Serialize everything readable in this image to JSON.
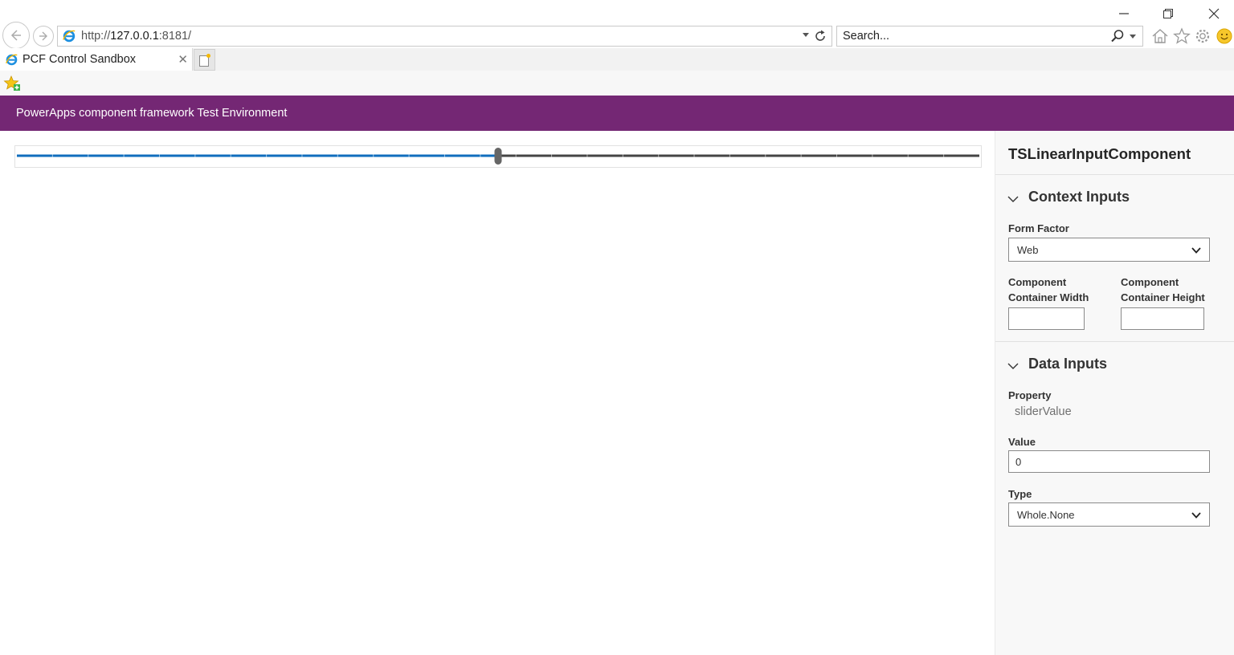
{
  "browser": {
    "address_host": "127.0.0.1",
    "address_prefix": "http://",
    "address_suffix": ":8181/",
    "search_placeholder": "Search...",
    "tab_title": "PCF Control Sandbox"
  },
  "app": {
    "header_title": "PowerApps component framework Test Environment",
    "accent_color": "#742774"
  },
  "slider": {
    "value_fraction": 0.5,
    "fill_color": "#106ebe",
    "track_color": "#444444"
  },
  "panel": {
    "component_name": "TSLinearInputComponent",
    "context_inputs": {
      "heading": "Context Inputs",
      "form_factor_label": "Form Factor",
      "form_factor_value": "Web",
      "width_label_1": "Component",
      "width_label_2": "Container Width",
      "height_label_1": "Component",
      "height_label_2": "Container Height",
      "width_value": "",
      "height_value": ""
    },
    "data_inputs": {
      "heading": "Data Inputs",
      "property_label": "Property",
      "property_value": "sliderValue",
      "value_label": "Value",
      "value_value": "0",
      "type_label": "Type",
      "type_value": "Whole.None"
    }
  }
}
